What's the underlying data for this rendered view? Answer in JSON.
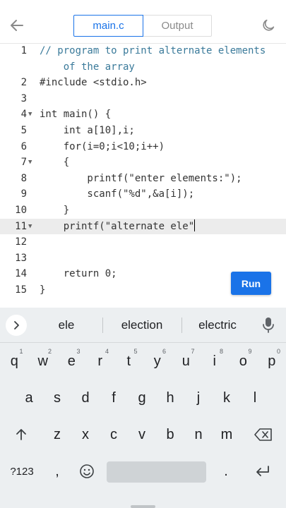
{
  "header": {
    "tabs": [
      {
        "label": "main.c",
        "active": true
      },
      {
        "label": "Output",
        "active": false
      }
    ]
  },
  "editor": {
    "active_line": 11,
    "lines": [
      {
        "n": "1",
        "fold": "",
        "text": "// program to print alternate elements",
        "kind": "comment"
      },
      {
        "n": "",
        "fold": "",
        "text": "    of the array",
        "kind": "comment"
      },
      {
        "n": "2",
        "fold": "",
        "text": "#include <stdio.h>",
        "kind": "include"
      },
      {
        "n": "3",
        "fold": "",
        "text": "",
        "kind": "code"
      },
      {
        "n": "4",
        "fold": "▼",
        "text": "int main() {",
        "kind": "code"
      },
      {
        "n": "5",
        "fold": "",
        "text": "    int a[10],i;",
        "kind": "code"
      },
      {
        "n": "6",
        "fold": "",
        "text": "    for(i=0;i<10;i++)",
        "kind": "code"
      },
      {
        "n": "7",
        "fold": "▼",
        "text": "    {",
        "kind": "code"
      },
      {
        "n": "8",
        "fold": "",
        "text": "        printf(\"enter elements:\");",
        "kind": "code"
      },
      {
        "n": "9",
        "fold": "",
        "text": "        scanf(\"%d\",&a[i]);",
        "kind": "code"
      },
      {
        "n": "10",
        "fold": "",
        "text": "    }",
        "kind": "code"
      },
      {
        "n": "11",
        "fold": "▼",
        "text": "    printf(\"alternate ele\"",
        "kind": "active"
      },
      {
        "n": "12",
        "fold": "",
        "text": "",
        "kind": "code"
      },
      {
        "n": "13",
        "fold": "",
        "text": "",
        "kind": "code"
      },
      {
        "n": "14",
        "fold": "",
        "text": "    return 0;",
        "kind": "code"
      },
      {
        "n": "15",
        "fold": "",
        "text": "}",
        "kind": "code"
      }
    ],
    "run_label": "Run"
  },
  "keyboard": {
    "suggestions": [
      "ele",
      "election",
      "electric"
    ],
    "row1": [
      {
        "k": "q",
        "h": "1"
      },
      {
        "k": "w",
        "h": "2"
      },
      {
        "k": "e",
        "h": "3"
      },
      {
        "k": "r",
        "h": "4"
      },
      {
        "k": "t",
        "h": "5"
      },
      {
        "k": "y",
        "h": "6"
      },
      {
        "k": "u",
        "h": "7"
      },
      {
        "k": "i",
        "h": "8"
      },
      {
        "k": "o",
        "h": "9"
      },
      {
        "k": "p",
        "h": "0"
      }
    ],
    "row2": [
      "a",
      "s",
      "d",
      "f",
      "g",
      "h",
      "j",
      "k",
      "l"
    ],
    "row3": [
      "z",
      "x",
      "c",
      "v",
      "b",
      "n",
      "m"
    ],
    "symbols_label": "?123",
    "comma_label": ",",
    "period_label": "."
  },
  "colors": {
    "accent": "#1a73e8",
    "keyboard_bg": "#eceff1"
  }
}
